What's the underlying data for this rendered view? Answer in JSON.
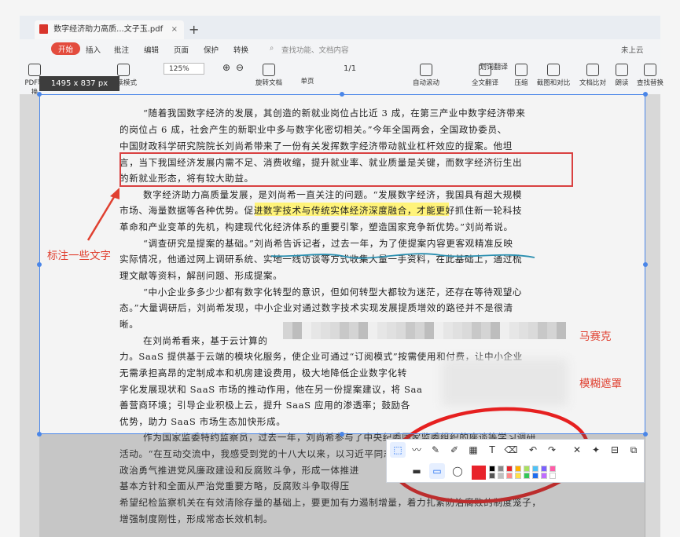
{
  "tab": {
    "title": "数字经济助力高质...文子玉.pdf",
    "close": "×",
    "new": "+"
  },
  "menu": {
    "start": "开始",
    "items": [
      "插入",
      "批注",
      "编辑",
      "页面",
      "保护",
      "转换"
    ],
    "search_placeholder": "查找功能、文档内容",
    "right": "未上云"
  },
  "toolbar": {
    "left_tools": [
      {
        "label": "PDF转换"
      },
      {
        "label": "阅读模式"
      },
      {
        "label": "旋转文档"
      },
      {
        "label": "单页"
      }
    ],
    "right_tools": [
      {
        "label": "自动滚动"
      },
      {
        "label": "全文翻译"
      },
      {
        "label": "压缩"
      },
      {
        "label": "截图和对比"
      },
      {
        "label": "文档比对"
      },
      {
        "label": "朗读"
      },
      {
        "label": "查找替换"
      }
    ],
    "zoom": "125%",
    "page": "1/1",
    "translate": "划词翻译",
    "selection_size": "1495  x  837  px"
  },
  "document": {
    "lines": [
      "“随着我国数字经济的发展，其创造的新就业岗位占比近 3 成，在第三产业中数字经济带来",
      "的岗位占 6 成，社会产生的新职业中多与数字化密切相关。”今年全国两会，全国政协委员、",
      "中国财政科学研究院院长刘尚希带来了一份有关发挥数字经济带动就业杠杆效应的提案。他坦",
      "言，当下我国经济发展内需不足、消费收缩，提升就业率、就业质量是关键，而数字经济衍生出",
      "的新就业形态，将有较大助益。",
      "数字经济助力高质量发展，是刘尚希一直关注的问题。“发展数字经济，我国具有超大规模",
      "市场、海量数据等各种优势。促进数字技术与传统实体经济深度融合，才能更好抓住新一轮科技",
      "革命和产业变革的先机，构建现代化经济体系的重要引擎，塑造国家竞争新优势。”刘尚希说。",
      "“调查研究是提案的基础。”刘尚希告诉记者，过去一年，为了使提案内容更客观精准反映",
      "实际情况，他通过网上调研系统、实地一线访谈等方式收集大量一手资料，在此基础上，通过梳",
      "理文献等资料，解剖问题、形成提案。",
      "“中小企业多多少少都有数字化转型的意识，但如何转型大都较为迷茫，还存在等待观望心",
      "态。”大量调研后，刘尚希发现，中小企业对通过数字技术实现发展提质增效的路径并不是很清",
      "晰。",
      "在刘尚希看来，基于云计算的",
      "力。SaaS 提供基于云端的模块化服务，使企业可通过“订阅模式”按需使用和付费，让中小企业",
      "无需承担高昂的定制成本和机房建设费用，极大地降低企业数字化转",
      "字化发展现状和 SaaS 市场的推动作用，他在另一份提案建议，将 Saa",
      "善营商环境；引导企业积极上云，提升  SaaS  应用的渗透率；鼓励各",
      "优势，助力 SaaS 市场生态加快形成。",
      "作为国家监委特约监察员，过去一年，刘尚希参与了中央纪委国家监委组织的座谈等学习调研",
      "活动。“在互动交流中，我感受到党的十八大以来，以习近平同志为核心的党中央以前所未有的",
      "政治勇气推进党风廉政建设和反腐败斗争，形成一体推进",
      "基本方针和全面从严治党重要方略，反腐败斗争取得压",
      "希望纪检监察机关在有效清除存量的基础上，要更加有力遏制增量，着力扎紧防治腐败的制度笼子，",
      "增强制度刚性，形成常态长效机制。"
    ],
    "highlight_text": "促进数字技术与传统实体经济深度融合"
  },
  "annotations": {
    "label_text": "标注一些文字",
    "mosaic_label": "马赛克",
    "blur_label": "模糊遮罩"
  },
  "annot_toolbar": {
    "tools": [
      "select",
      "draw-line",
      "pen",
      "highlighter",
      "mosaic",
      "text",
      "eraser",
      "undo",
      "redo",
      "close",
      "pin",
      "save",
      "copy"
    ],
    "shapes": [
      "rect-fill",
      "rect",
      "ellipse"
    ],
    "current_color": "#e8232b",
    "palette": [
      "#000000",
      "#555555",
      "#888888",
      "#c0c0c0",
      "#e8232b",
      "#ff8a8a",
      "#ffb000",
      "#ffe04a",
      "#a8e05f",
      "#34c759",
      "#4fc3f7",
      "#1e6df0",
      "#7b61ff",
      "#c06cff",
      "#ff5ca8",
      "#ffffff"
    ]
  },
  "colors": {
    "annotation_red": "#e04030",
    "selection_blue": "#4a86e8",
    "highlight": "#fff37a"
  }
}
